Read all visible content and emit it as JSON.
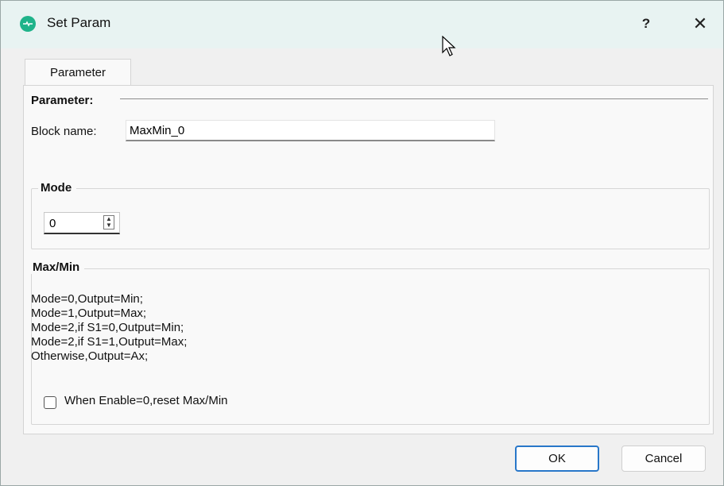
{
  "window": {
    "title": "Set Param",
    "help_label": "?",
    "close_label": "✕"
  },
  "tabs": [
    {
      "label": "Parameter"
    }
  ],
  "parameter_section": {
    "heading": "Parameter:",
    "block_name_label": "Block name:",
    "block_name_value": "MaxMin_0"
  },
  "mode_group": {
    "heading": "Mode",
    "value": "0",
    "up_arrow": "▲",
    "down_arrow": "▼"
  },
  "maxmin_group": {
    "heading": "Max/Min",
    "lines": [
      "Mode=0,Output=Min;",
      "Mode=1,Output=Max;",
      "Mode=2,if S1=0,Output=Min;",
      "Mode=2,if S1=1,Output=Max;",
      "Otherwise,Output=Ax;"
    ],
    "checkbox_label": "When Enable=0,reset Max/Min",
    "checkbox_checked": false
  },
  "buttons": {
    "ok": "OK",
    "cancel": "Cancel"
  },
  "colors": {
    "titlebar": "#e8f3f2",
    "app_icon": "#1fb38a",
    "default_button_border": "#2877c9"
  }
}
